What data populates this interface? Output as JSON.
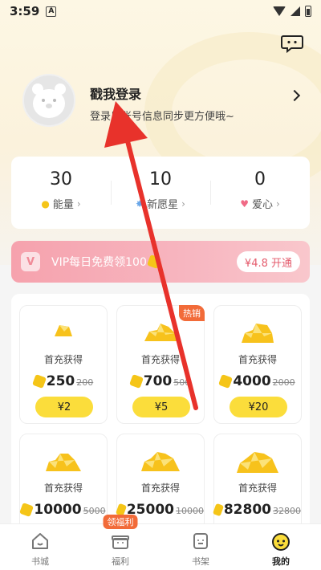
{
  "status_bar": {
    "time": "3:59",
    "notification_letter": "A"
  },
  "header": {
    "chat_icon": "chat-bubble-icon"
  },
  "profile": {
    "title": "戳我登录",
    "subtitle": "登录后账号信息同步更方便哦~"
  },
  "stats": [
    {
      "value": "30",
      "label": "能量",
      "icon": "energy-icon",
      "icon_color": "#f5c518"
    },
    {
      "value": "10",
      "label": "新愿星",
      "icon": "star-icon",
      "icon_color": "#6aa7e8"
    },
    {
      "value": "0",
      "label": "爱心",
      "icon": "heart-icon",
      "icon_color": "#f06a86"
    }
  ],
  "vip": {
    "text": "VIP每日免费领100",
    "price": "¥4.8 开通"
  },
  "packages": [
    {
      "label": "首充获得",
      "value": "250",
      "old": "200",
      "price": "¥2",
      "hot": ""
    },
    {
      "label": "首充获得",
      "value": "700",
      "old": "500",
      "price": "¥5",
      "hot": "热销"
    },
    {
      "label": "首充获得",
      "value": "4000",
      "old": "2000",
      "price": "¥20",
      "hot": ""
    },
    {
      "label": "首充获得",
      "value": "10000",
      "old": "5000",
      "price": "",
      "hot": ""
    },
    {
      "label": "首充获得",
      "value": "25000",
      "old": "10000",
      "price": "",
      "hot": ""
    },
    {
      "label": "首充获得",
      "value": "82800",
      "old": "32800",
      "price": "",
      "hot": ""
    }
  ],
  "bottom_nav": [
    {
      "label": "书城",
      "icon": "home-icon",
      "badge": ""
    },
    {
      "label": "福利",
      "icon": "gift-icon",
      "badge": "领福利"
    },
    {
      "label": "书架",
      "icon": "bookshelf-icon",
      "badge": ""
    },
    {
      "label": "我的",
      "icon": "profile-face-icon",
      "badge": ""
    }
  ],
  "colors": {
    "accent_yellow": "#fbdd3b",
    "hot_orange": "#f26b39",
    "vip_pink": "#f6a2ad",
    "annotation_red": "#e8322b"
  }
}
